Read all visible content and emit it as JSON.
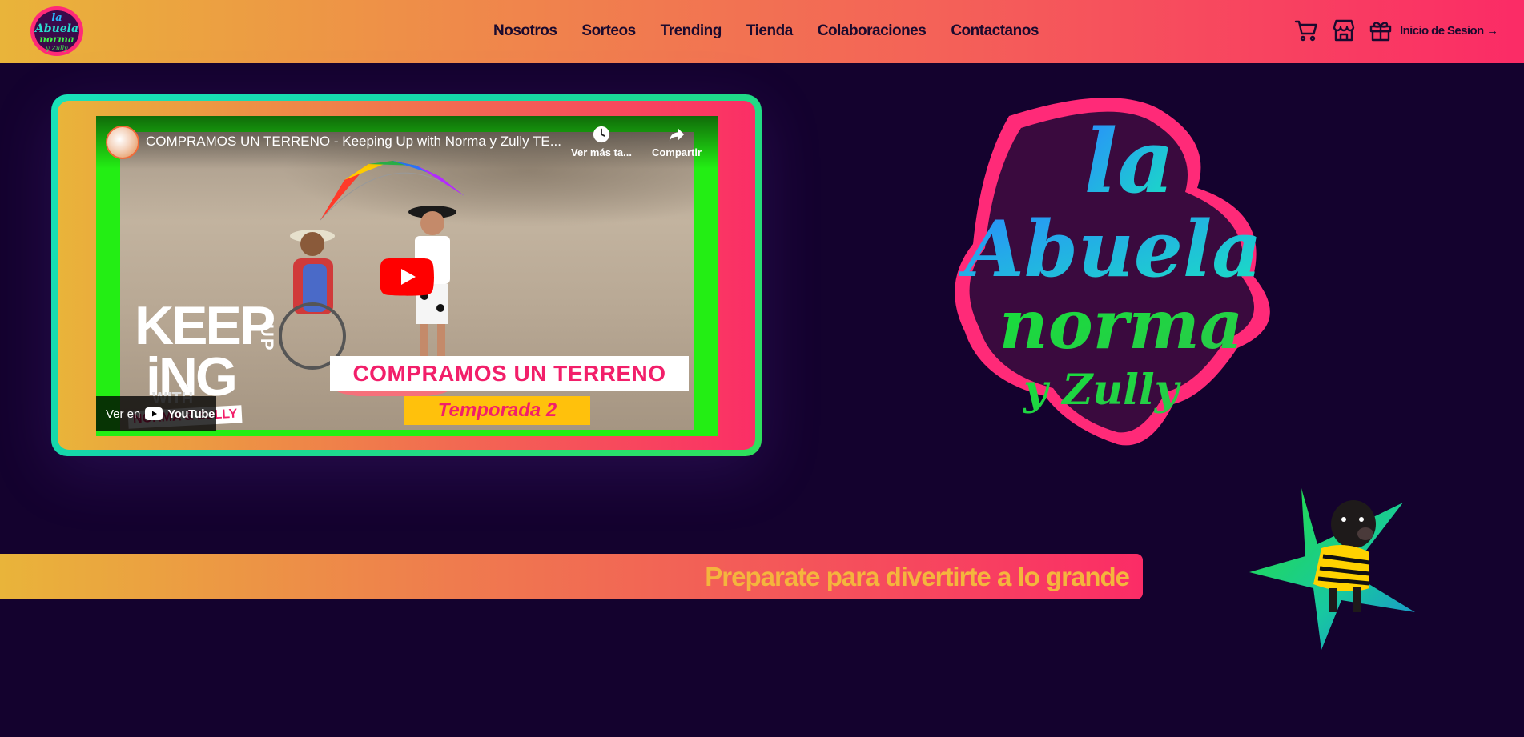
{
  "header": {
    "logo_alt": "La Abuela Norma y Zully",
    "nav": [
      "Nosotros",
      "Sorteos",
      "Trending",
      "Tienda",
      "Colaboraciones",
      "Contactanos"
    ],
    "icons": [
      "cart-icon",
      "store-icon",
      "gift-icon"
    ],
    "login_label": "Inicio de Sesion →"
  },
  "video": {
    "title": "COMPRAMOS UN TERRENO - Keeping Up with Norma y Zully TE...",
    "watch_later": "Ver más ta...",
    "share": "Compartir",
    "watch_on": "Ver en",
    "youtube": "YouTube",
    "thumb_headline": "COMPRAMOS UN TERRENO",
    "thumb_season": "Temporada 2",
    "thumb_keep": "KEEP",
    "thumb_ing": "iNG",
    "thumb_up": "UP",
    "thumb_with": "WITH",
    "thumb_names": "NORMA & ZULLY"
  },
  "brand_logo": {
    "line1": "la",
    "line2": "Abuela",
    "line3": "norma",
    "line4": "y Zully"
  },
  "tagline": "Preparate para divertirte a lo grande",
  "colors": {
    "background": "#14022e",
    "gradient_start": "#e9b43a",
    "gradient_end": "#fb2b66",
    "accent_green": "#23ee14",
    "accent_teal": "#19e2b9"
  }
}
